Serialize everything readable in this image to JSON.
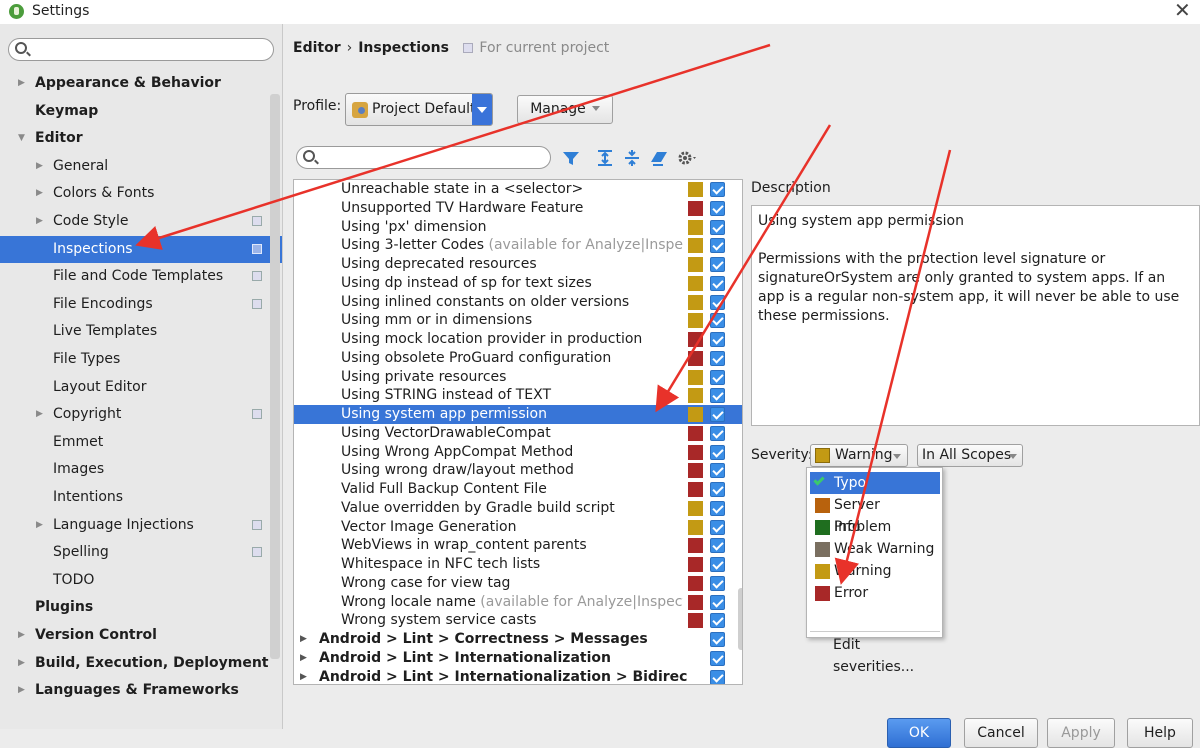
{
  "window": {
    "title": "Settings",
    "close_glyph": "✕"
  },
  "sidebar": {
    "search_placeholder": "",
    "items": [
      {
        "label": "Appearance & Behavior",
        "level": 0,
        "bold": true,
        "arrow": "right"
      },
      {
        "label": "Keymap",
        "level": 0,
        "bold": true
      },
      {
        "label": "Editor",
        "level": 0,
        "bold": true,
        "arrow": "down"
      },
      {
        "label": "General",
        "level": 1,
        "arrow": "right"
      },
      {
        "label": "Colors & Fonts",
        "level": 1,
        "arrow": "right"
      },
      {
        "label": "Code Style",
        "level": 1,
        "arrow": "right",
        "project_icon": true
      },
      {
        "label": "Inspections",
        "level": 1,
        "selected": true,
        "project_icon": true
      },
      {
        "label": "File and Code Templates",
        "level": 1,
        "project_icon": true
      },
      {
        "label": "File Encodings",
        "level": 1,
        "project_icon": true
      },
      {
        "label": "Live Templates",
        "level": 1
      },
      {
        "label": "File Types",
        "level": 1
      },
      {
        "label": "Layout Editor",
        "level": 1
      },
      {
        "label": "Copyright",
        "level": 1,
        "arrow": "right",
        "project_icon": true
      },
      {
        "label": "Emmet",
        "level": 1
      },
      {
        "label": "Images",
        "level": 1
      },
      {
        "label": "Intentions",
        "level": 1
      },
      {
        "label": "Language Injections",
        "level": 1,
        "arrow": "right",
        "project_icon": true
      },
      {
        "label": "Spelling",
        "level": 1,
        "project_icon": true
      },
      {
        "label": "TODO",
        "level": 1
      },
      {
        "label": "Plugins",
        "level": 0,
        "bold": true
      },
      {
        "label": "Version Control",
        "level": 0,
        "bold": true,
        "arrow": "right"
      },
      {
        "label": "Build, Execution, Deployment",
        "level": 0,
        "bold": true,
        "arrow": "right"
      },
      {
        "label": "Languages & Frameworks",
        "level": 0,
        "bold": true,
        "arrow": "right"
      }
    ]
  },
  "breadcrumb": {
    "part1": "Editor",
    "separator": "›",
    "part2": "Inspections",
    "scope": "For current project"
  },
  "profile": {
    "label": "Profile:",
    "value": "Project Default",
    "manage_label": "Manage"
  },
  "inspection_search": {
    "placeholder": ""
  },
  "toolbar": {
    "icons": [
      "filter-icon",
      "expand-all-icon",
      "collapse-all-icon",
      "reset-icon",
      "gear-icon"
    ]
  },
  "colors": {
    "warning": "#c39a14",
    "error": "#a82828",
    "typo": "#3bc96d",
    "server_problem": "#b8620d",
    "info": "#1f6e1f",
    "weak_warning": "#7a6f60",
    "selection": "#3875d7"
  },
  "inspections": [
    {
      "label": "Unreachable state in a <selector>",
      "severity": "warning"
    },
    {
      "label": "Unsupported TV Hardware Feature",
      "severity": "error"
    },
    {
      "label": "Using 'px' dimension",
      "severity": "warning"
    },
    {
      "label": "Using 3-letter Codes",
      "extra": "(available for Analyze|Inspect Code)",
      "severity": "warning"
    },
    {
      "label": "Using deprecated resources",
      "severity": "warning"
    },
    {
      "label": "Using dp instead of sp for text sizes",
      "severity": "warning"
    },
    {
      "label": "Using inlined constants on older versions",
      "severity": "warning"
    },
    {
      "label": "Using mm or in dimensions",
      "severity": "warning"
    },
    {
      "label": "Using mock location provider in production",
      "severity": "error"
    },
    {
      "label": "Using obsolete ProGuard configuration",
      "severity": "error"
    },
    {
      "label": "Using private resources",
      "severity": "warning"
    },
    {
      "label": "Using STRING instead of TEXT",
      "severity": "warning"
    },
    {
      "label": "Using system app permission",
      "severity": "warning",
      "selected": true
    },
    {
      "label": "Using VectorDrawableCompat",
      "severity": "error"
    },
    {
      "label": "Using Wrong AppCompat Method",
      "severity": "error"
    },
    {
      "label": "Using wrong draw/layout method",
      "severity": "error"
    },
    {
      "label": "Valid Full Backup Content File",
      "severity": "error"
    },
    {
      "label": "Value overridden by Gradle build script",
      "severity": "warning"
    },
    {
      "label": "Vector Image Generation",
      "severity": "warning"
    },
    {
      "label": "WebViews in wrap_content parents",
      "severity": "error"
    },
    {
      "label": "Whitespace in NFC tech lists",
      "severity": "error"
    },
    {
      "label": "Wrong case for view tag",
      "severity": "error"
    },
    {
      "label": "Wrong locale name",
      "extra": "(available for Analyze|Inspect Code)",
      "severity": "error"
    },
    {
      "label": "Wrong system service casts",
      "severity": "error"
    },
    {
      "label": "Android > Lint > Correctness > Messages",
      "group": true
    },
    {
      "label": "Android > Lint > Internationalization",
      "group": true
    },
    {
      "label": "Android > Lint > Internationalization > Bidirectional Text",
      "group": true
    }
  ],
  "description": {
    "label": "Description",
    "title": "Using system app permission",
    "body": "Permissions with the protection level signature or signatureOrSystem are only granted to system apps. If an app is a regular non-system app, it will never be able to use these permissions."
  },
  "severity": {
    "label": "Severity:",
    "value": "Warning",
    "scope": "In All Scopes"
  },
  "severity_popup": {
    "items": [
      {
        "label": "Typo",
        "color": "#3875d7",
        "selected": true
      },
      {
        "label": "Server Problem",
        "color": "#b8620d"
      },
      {
        "label": "Info",
        "color": "#1f6e1f"
      },
      {
        "label": "Weak Warning",
        "color": "#7a6f60"
      },
      {
        "label": "Warning",
        "color": "#c39a14"
      },
      {
        "label": "Error",
        "color": "#a82828"
      }
    ],
    "edit_label": "Edit severities..."
  },
  "footer": {
    "ok": "OK",
    "cancel": "Cancel",
    "apply": "Apply",
    "help": "Help"
  }
}
